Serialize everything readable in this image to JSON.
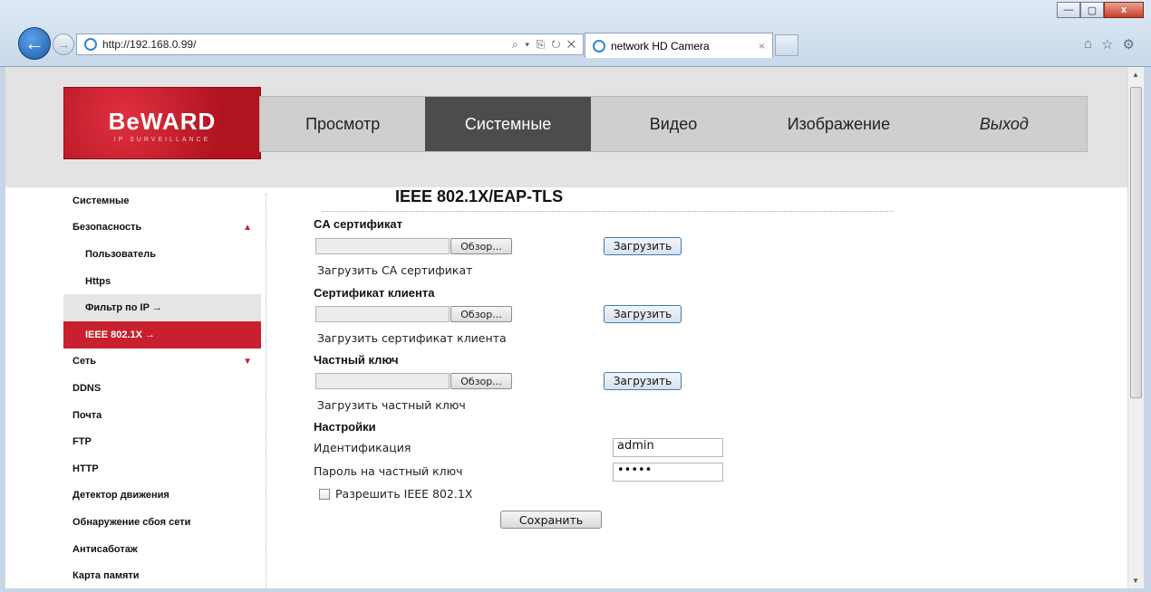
{
  "browser": {
    "window_buttons": {
      "minimize": "—",
      "maximize": "▢",
      "close": "x"
    },
    "address": "http://192.168.0.99/",
    "address_tools": "⌕ ▾ ⎘ ↻ ✕",
    "tab_title": "network HD Camera",
    "tab_close": "×",
    "right_icons": [
      "⌂",
      "☆",
      "⚙"
    ]
  },
  "header": {
    "logo_text": "BeWARD",
    "logo_sub": "IP SURVEILLANCE",
    "nav": [
      {
        "label": "Просмотр"
      },
      {
        "label": "Системные"
      },
      {
        "label": "Видео"
      },
      {
        "label": "Изображение"
      },
      {
        "label": "Выход"
      }
    ]
  },
  "sidebar": {
    "items": [
      {
        "label": "Системные"
      },
      {
        "label": "Безопасность",
        "marker": "▲"
      },
      {
        "label": "Пользователь"
      },
      {
        "label": "Https"
      },
      {
        "label": "Фильтр по IP →"
      },
      {
        "label": "IEEE 802.1X →"
      },
      {
        "label": "Сеть",
        "marker": "▼"
      },
      {
        "label": "DDNS"
      },
      {
        "label": "Почта"
      },
      {
        "label": "FTP"
      },
      {
        "label": "HTTP"
      },
      {
        "label": "Детектор движения"
      },
      {
        "label": "Обнаружение сбоя сети"
      },
      {
        "label": "Антисаботаж"
      },
      {
        "label": "Карта памяти"
      }
    ]
  },
  "content": {
    "title": "IEEE 802.1X/EAP-TLS",
    "browse_label": "Обзор...",
    "upload_label": "Загрузить",
    "ca": {
      "title": "CA сертификат",
      "hint": "Загрузить CA сертификат"
    },
    "client": {
      "title": "Сертификат клиента",
      "hint": "Загрузить сертификат клиента"
    },
    "key": {
      "title": "Частный ключ",
      "hint": "Загрузить частный ключ"
    },
    "settings": {
      "title": "Настройки",
      "identity_label": "Идентификация",
      "identity_value": "admin",
      "password_label": "Пароль на частный ключ",
      "password_value": "•••••",
      "enable_label": "Разрешить IEEE 802.1X",
      "save_label": "Сохранить"
    }
  }
}
